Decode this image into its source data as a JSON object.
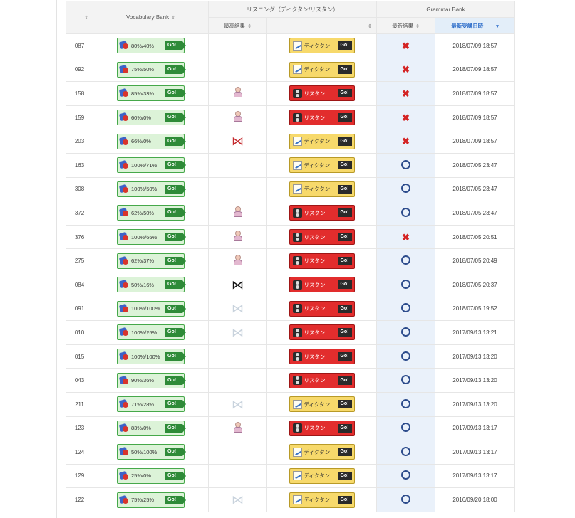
{
  "header": {
    "vocab_group": "Vocabulary Bank",
    "listening_group": "リスニング（ディクタン/リスタン）",
    "grammar_group": "Grammar Bank",
    "best_result": "最高結果",
    "latest_result": "最新結果",
    "latest_date": "最新受講日時",
    "sort_icon": "⇕",
    "sort_down_icon": "▾"
  },
  "go_label": "Go!",
  "listen_labels": {
    "dict": "ディクタン",
    "list": "リスタン"
  },
  "icons": {
    "belt_glyph": "⋈",
    "x_glyph": "✖"
  },
  "rows": [
    {
      "id": "087",
      "vocab": "80%/40%",
      "best": "",
      "listen": "dict",
      "grammar": "x",
      "date": "2018/07/09 18:57"
    },
    {
      "id": "092",
      "vocab": "75%/50%",
      "best": "",
      "listen": "dict",
      "grammar": "x",
      "date": "2018/07/09 18:57"
    },
    {
      "id": "158",
      "vocab": "85%/33%",
      "best": "medal",
      "listen": "list",
      "grammar": "x",
      "date": "2018/07/09 18:57"
    },
    {
      "id": "159",
      "vocab": "60%/0%",
      "best": "medal",
      "listen": "list",
      "grammar": "x",
      "date": "2018/07/09 18:57"
    },
    {
      "id": "203",
      "vocab": "66%/0%",
      "best": "belt-red",
      "listen": "dict",
      "grammar": "x",
      "date": "2018/07/09 18:57"
    },
    {
      "id": "163",
      "vocab": "100%/71%",
      "best": "",
      "listen": "dict",
      "grammar": "o",
      "date": "2018/07/05 23:47"
    },
    {
      "id": "308",
      "vocab": "100%/50%",
      "best": "",
      "listen": "dict",
      "grammar": "o",
      "date": "2018/07/05 23:47"
    },
    {
      "id": "372",
      "vocab": "62%/50%",
      "best": "medal",
      "listen": "list",
      "grammar": "o",
      "date": "2018/07/05 23:47"
    },
    {
      "id": "376",
      "vocab": "100%/66%",
      "best": "medal",
      "listen": "list",
      "grammar": "x",
      "date": "2018/07/05 20:51"
    },
    {
      "id": "275",
      "vocab": "62%/37%",
      "best": "medal",
      "listen": "list",
      "grammar": "o",
      "date": "2018/07/05 20:49"
    },
    {
      "id": "084",
      "vocab": "50%/16%",
      "best": "belt-black",
      "listen": "list",
      "grammar": "o",
      "date": "2018/07/05 20:37"
    },
    {
      "id": "091",
      "vocab": "100%/100%",
      "best": "belt-white",
      "listen": "list",
      "grammar": "o",
      "date": "2018/07/05 19:52"
    },
    {
      "id": "010",
      "vocab": "100%/25%",
      "best": "belt-white",
      "listen": "list",
      "grammar": "o",
      "date": "2017/09/13 13:21"
    },
    {
      "id": "015",
      "vocab": "100%/100%",
      "best": "",
      "listen": "list",
      "grammar": "o",
      "date": "2017/09/13 13:20"
    },
    {
      "id": "043",
      "vocab": "90%/36%",
      "best": "",
      "listen": "list",
      "grammar": "o",
      "date": "2017/09/13 13:20"
    },
    {
      "id": "211",
      "vocab": "71%/28%",
      "best": "belt-white",
      "listen": "dict",
      "grammar": "o",
      "date": "2017/09/13 13:20"
    },
    {
      "id": "123",
      "vocab": "83%/0%",
      "best": "medal",
      "listen": "list",
      "grammar": "o",
      "date": "2017/09/13 13:17"
    },
    {
      "id": "124",
      "vocab": "50%/100%",
      "best": "",
      "listen": "dict",
      "grammar": "o",
      "date": "2017/09/13 13:17"
    },
    {
      "id": "129",
      "vocab": "25%/0%",
      "best": "",
      "listen": "dict",
      "grammar": "o",
      "date": "2017/09/13 13:17"
    },
    {
      "id": "122",
      "vocab": "75%/25%",
      "best": "belt-white",
      "listen": "dict",
      "grammar": "o",
      "date": "2016/09/20 18:00"
    }
  ]
}
